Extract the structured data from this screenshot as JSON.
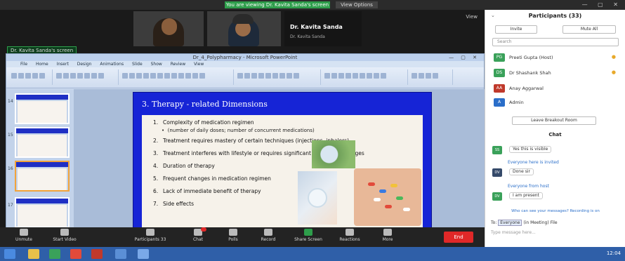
{
  "top_strip": {
    "share_banner": "You are viewing Dr. Kavita Sanda's screen",
    "view_options": "View Options"
  },
  "videos": {
    "tile1_name": "",
    "tile2_name": "",
    "presenter_name": "Dr. Kavita Sanda",
    "presenter_sub": "Dr. Kavita Sanda"
  },
  "view_button": "View",
  "shared_label": "Dr. Kavita Sanda's screen",
  "ppt": {
    "window_title": "Dr_4_Polypharmacy - Microsoft PowerPoint",
    "menu": [
      "File",
      "Home",
      "Insert",
      "Design",
      "Animations",
      "Slide Show",
      "Review",
      "View"
    ]
  },
  "slide": {
    "title": "3. Therapy - related Dimensions",
    "items": [
      {
        "num": "1.",
        "text": "Complexity of medication regimen"
      },
      {
        "num": "2.",
        "text": "Treatment requires mastery of certain techniques (injections, inhalers)"
      },
      {
        "num": "3.",
        "text": "Treatment interferes with lifestyle or requires significant behavioral changes"
      },
      {
        "num": "4.",
        "text": "Duration of therapy"
      },
      {
        "num": "5.",
        "text": "Frequent changes in medication regimen"
      },
      {
        "num": "6.",
        "text": "Lack of immediate benefit of therapy"
      },
      {
        "num": "7.",
        "text": "Side effects"
      }
    ],
    "sub_bullet": "(number of daily doses; number of concurrent medications)"
  },
  "thumbs": [
    {
      "num": "14"
    },
    {
      "num": "15"
    },
    {
      "num": "16"
    },
    {
      "num": "17"
    }
  ],
  "toolbar": {
    "unmute": "Unmute",
    "stop_video": "Start Video",
    "participants": "Participants",
    "participant_count": "33",
    "chat": "Chat",
    "share_screen": "Share Screen",
    "polls": "Polls",
    "record": "Record",
    "reactions": "Reactions",
    "more": "More",
    "end": "End"
  },
  "panel": {
    "title": "Participants (33)",
    "invite": "Invite",
    "mute_all": "Mute All",
    "search_placeholder": "Search",
    "participants": [
      {
        "initials": "PG",
        "name": "Preeti Gupta (Host)",
        "color": "#3aa15a"
      },
      {
        "initials": "DS",
        "name": "Dr Shashank Shah",
        "color": "#3aa15a"
      },
      {
        "initials": "AA",
        "name": "Anay Aggarwal",
        "color": "#c0392b"
      },
      {
        "initials": "A",
        "name": "Admin",
        "color": "#2a6ec9"
      }
    ],
    "leave_button": "Leave Breakout Room",
    "chat_title": "Chat",
    "chat": [
      {
        "from": "",
        "initials": "SS",
        "avatar_color": "#3aa15a",
        "msg": "Yes this is visible"
      },
      {
        "from": "Everyone here is invited",
        "initials": "DV",
        "avatar_color": "#354a6a",
        "msg": "Done sir"
      },
      {
        "from": "Everyone from host",
        "initials": "DV",
        "avatar_color": "#3aa15a",
        "msg": "I am present"
      }
    ],
    "note": "Who can see your messages? Recording is on",
    "to_label": "To:",
    "to_value": "Everyone",
    "to_suffix": "(in Meeting)",
    "file_label": "File",
    "message_placeholder": "Type message here..."
  },
  "taskbar": {
    "clock": "12:04"
  }
}
